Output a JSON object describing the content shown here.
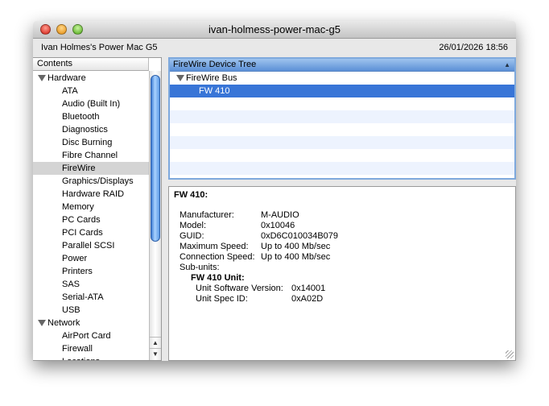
{
  "window": {
    "title": "ivan-holmess-power-mac-g5",
    "computer_name": "Ivan Holmes's Power Mac G5",
    "datetime": "26/01/2026 18:56"
  },
  "sidebar": {
    "header": "Contents",
    "items": [
      {
        "label": "Hardware",
        "type": "cat"
      },
      {
        "label": "ATA"
      },
      {
        "label": "Audio (Built In)"
      },
      {
        "label": "Bluetooth"
      },
      {
        "label": "Diagnostics"
      },
      {
        "label": "Disc Burning"
      },
      {
        "label": "Fibre Channel"
      },
      {
        "label": "FireWire",
        "selected": true
      },
      {
        "label": "Graphics/Displays"
      },
      {
        "label": "Hardware RAID"
      },
      {
        "label": "Memory"
      },
      {
        "label": "PC Cards"
      },
      {
        "label": "PCI Cards"
      },
      {
        "label": "Parallel SCSI"
      },
      {
        "label": "Power"
      },
      {
        "label": "Printers"
      },
      {
        "label": "SAS"
      },
      {
        "label": "Serial-ATA"
      },
      {
        "label": "USB"
      },
      {
        "label": "Network",
        "type": "cat"
      },
      {
        "label": "AirPort Card"
      },
      {
        "label": "Firewall"
      },
      {
        "label": "Locations"
      }
    ]
  },
  "tree": {
    "header": "FireWire Device Tree",
    "bus": "FireWire Bus",
    "device": "FW 410"
  },
  "detail": {
    "title": "FW 410:",
    "fields": [
      {
        "k": "Manufacturer:",
        "v": "M-AUDIO"
      },
      {
        "k": "Model:",
        "v": "0x10046"
      },
      {
        "k": "GUID:",
        "v": "0xD6C010034B079"
      },
      {
        "k": "Maximum Speed:",
        "v": "Up to 400 Mb/sec"
      },
      {
        "k": "Connection Speed:",
        "v": "Up to 400 Mb/sec"
      },
      {
        "k": "Sub-units:",
        "v": ""
      }
    ],
    "unit_title": "FW 410 Unit:",
    "unit_fields": [
      {
        "k": "Unit Software Version:",
        "v": "0x14001"
      },
      {
        "k": "Unit Spec ID:",
        "v": "0xA02D"
      }
    ]
  }
}
